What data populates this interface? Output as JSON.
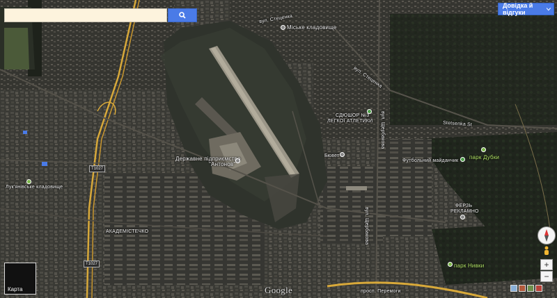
{
  "search": {
    "value": "",
    "placeholder": ""
  },
  "help_button": {
    "label": "Довідка й відгуки"
  },
  "map_type_thumb": {
    "label": "Карта"
  },
  "logo": "Google",
  "labels": {
    "miske_kladovyshche": "Міське кладовище",
    "vul_stetsenka_top": "вул. Стеценка",
    "vul_stetsenka_mid": "вул. Стеценка",
    "sdyushor": "СДЮШОР №3",
    "lehkoi_atletyky": "ЛЕГКОЇ АТЛЕТИКИ",
    "stetsenka_st": "Stetsenka St",
    "park_dubky": "парк Дубки",
    "buvet": "Бювет",
    "futbolnyi": "Футбольний майданчик",
    "antonov_1": "Державне підприємство",
    "antonov_2": "\"Антонов\"",
    "vul_shcherbakova": "вул. Щербакова",
    "vul_shcherbakova2": "вул. Щербакова",
    "ferz": "ФЕРЗЬ",
    "reklamno": "РЕКЛАМНО",
    "akademmistechko": "АКАДЕМІСТЕЧКО",
    "park_nyvky": "парк Нивки",
    "prosp_peremohy": "просп. Перемоги",
    "lukianivske": "Лук'янівське кладовище",
    "road_t1027_a": "T1027",
    "road_t1027_b": "T1027"
  },
  "controls": {
    "zoom_in": "+",
    "zoom_out": "−"
  },
  "colors": {
    "accent": "#4a7be7",
    "search_bg": "#fdf3dd",
    "road": "#d8a93a",
    "park_label": "#b6e86a"
  }
}
